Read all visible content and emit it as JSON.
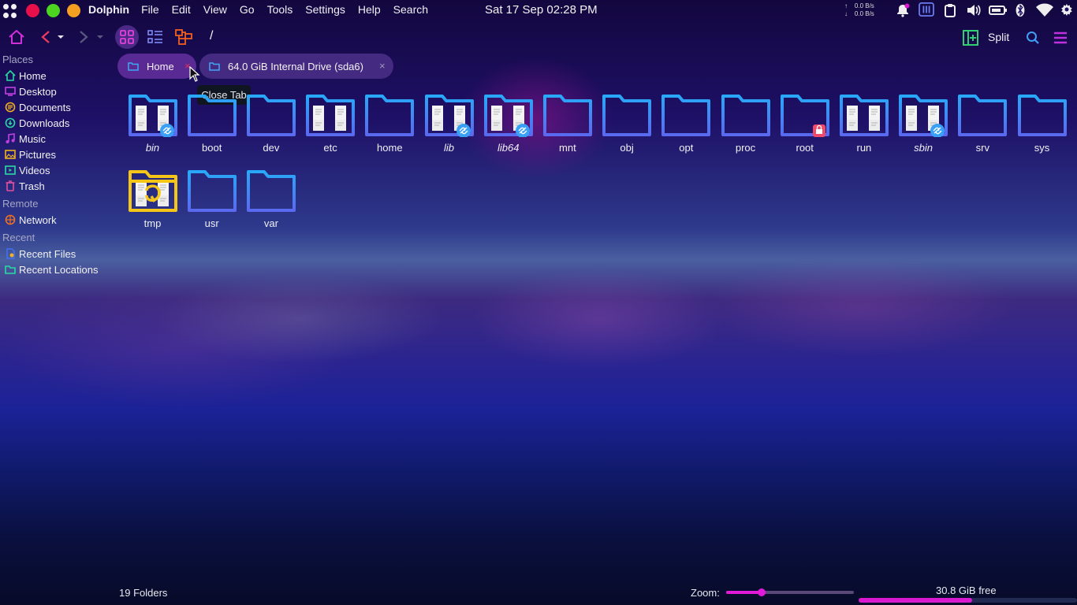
{
  "topbar": {
    "app_name": "Dolphin",
    "menus": [
      "File",
      "Edit",
      "View",
      "Go",
      "Tools",
      "Settings",
      "Help",
      "Search"
    ],
    "clock": "Sat 17 Sep  02:28 PM",
    "net_up": "0.0 B/s",
    "net_down": "0.0 B/s",
    "window_buttons": [
      "#e8104a",
      "#4cd620",
      "#f5a020"
    ],
    "tray_icons": [
      "bell-icon",
      "equalizer-icon",
      "clipboard-icon",
      "volume-icon",
      "battery-icon",
      "bluetooth-icon",
      "wifi-icon"
    ]
  },
  "toolbar": {
    "icons": [
      "home-icon",
      "back-icon",
      "forward-icon",
      "icons-view-icon",
      "details-view-icon",
      "tree-view-icon"
    ],
    "breadcrumb": "/",
    "split_label": "Split",
    "right_icons": [
      "split-icon",
      "search-icon",
      "hamburger-menu-icon"
    ]
  },
  "sidebar": {
    "places_label": "Places",
    "places": [
      {
        "label": "Home",
        "icon": "home-icon",
        "color": "#2ad9a4"
      },
      {
        "label": "Desktop",
        "icon": "desktop-icon",
        "color": "#c040e0"
      },
      {
        "label": "Documents",
        "icon": "documents-icon",
        "color": "#f0b020"
      },
      {
        "label": "Downloads",
        "icon": "download-icon",
        "color": "#2ad9a4"
      },
      {
        "label": "Music",
        "icon": "music-icon",
        "color": "#c040e0"
      },
      {
        "label": "Pictures",
        "icon": "pictures-icon",
        "color": "#f0b020"
      },
      {
        "label": "Videos",
        "icon": "videos-icon",
        "color": "#2ad9a4"
      },
      {
        "label": "Trash",
        "icon": "trash-icon",
        "color": "#e050a0"
      }
    ],
    "remote_label": "Remote",
    "remote": [
      {
        "label": "Network",
        "icon": "network-icon",
        "color": "#f07020"
      }
    ],
    "recent_label": "Recent",
    "recent": [
      {
        "label": "Recent Files",
        "icon": "recent-files-icon",
        "color": "#4070f0"
      },
      {
        "label": "Recent Locations",
        "icon": "recent-locations-icon",
        "color": "#2ad9a4"
      }
    ]
  },
  "tabs": [
    {
      "label": "Home",
      "icon": "folder-icon"
    },
    {
      "label": "64.0 GiB Internal Drive (sda6)",
      "icon": "folder-icon"
    }
  ],
  "tooltip": "Close Tab",
  "files": [
    {
      "name": "bin",
      "italic": true,
      "papers": true,
      "badge": "link"
    },
    {
      "name": "boot",
      "italic": false,
      "papers": false,
      "badge": ""
    },
    {
      "name": "dev",
      "italic": false,
      "papers": false,
      "badge": ""
    },
    {
      "name": "etc",
      "italic": false,
      "papers": true,
      "badge": ""
    },
    {
      "name": "home",
      "italic": false,
      "papers": false,
      "badge": ""
    },
    {
      "name": "lib",
      "italic": true,
      "papers": true,
      "badge": "link"
    },
    {
      "name": "lib64",
      "italic": true,
      "papers": true,
      "badge": "link"
    },
    {
      "name": "mnt",
      "italic": false,
      "papers": false,
      "badge": ""
    },
    {
      "name": "obj",
      "italic": false,
      "papers": false,
      "badge": ""
    },
    {
      "name": "opt",
      "italic": false,
      "papers": false,
      "badge": ""
    },
    {
      "name": "proc",
      "italic": false,
      "papers": false,
      "badge": ""
    },
    {
      "name": "root",
      "italic": false,
      "papers": false,
      "badge": "lock"
    },
    {
      "name": "run",
      "italic": false,
      "papers": true,
      "badge": ""
    },
    {
      "name": "sbin",
      "italic": true,
      "papers": true,
      "badge": "link"
    },
    {
      "name": "srv",
      "italic": false,
      "papers": false,
      "badge": ""
    },
    {
      "name": "sys",
      "italic": false,
      "papers": false,
      "badge": ""
    },
    {
      "name": "tmp",
      "italic": false,
      "papers": true,
      "badge": "",
      "color": "yellow"
    },
    {
      "name": "usr",
      "italic": false,
      "papers": false,
      "badge": ""
    },
    {
      "name": "var",
      "italic": false,
      "papers": false,
      "badge": ""
    }
  ],
  "statusbar": {
    "folder_count": "19 Folders",
    "zoom_label": "Zoom:",
    "zoom_level": 0.28,
    "free_space": "30.8 GiB free",
    "disk_used_fraction": 0.52
  },
  "colors": {
    "folder": "#2a8ef5",
    "folder_tmp": "#f5c518",
    "accent": "#d918d0",
    "tab_bg": "#552a8c"
  }
}
